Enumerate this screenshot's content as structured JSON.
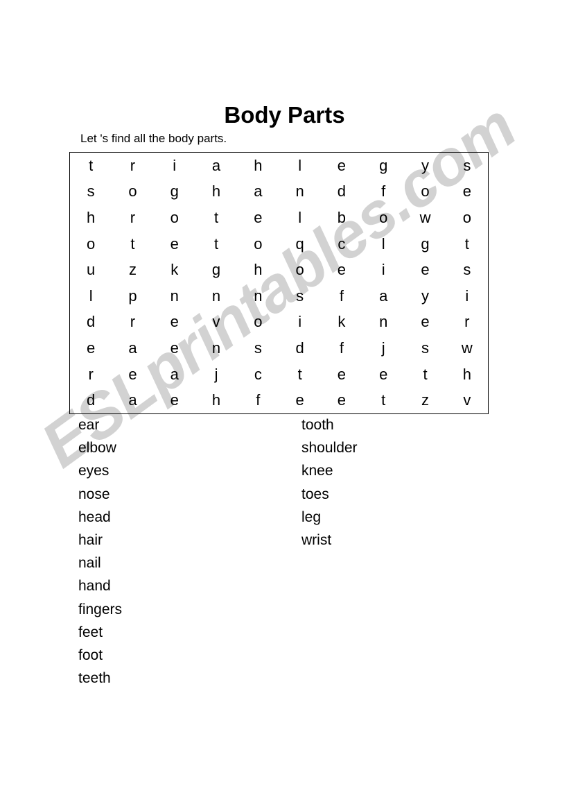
{
  "worksheet": {
    "title": "Body Parts",
    "instruction": "Let 's find all the body parts."
  },
  "watermark": {
    "text": "ESLprintables.com",
    "color": "#d2d2d2"
  },
  "puzzle": {
    "rows": 10,
    "cols": 10,
    "grid": [
      [
        "t",
        "r",
        "i",
        "a",
        "h",
        "l",
        "e",
        "g",
        "y",
        "s"
      ],
      [
        "s",
        "o",
        "g",
        "h",
        "a",
        "n",
        "d",
        "f",
        "o",
        "e"
      ],
      [
        "h",
        "r",
        "o",
        "t",
        "e",
        "l",
        "b",
        "o",
        "w",
        "o"
      ],
      [
        "o",
        "t",
        "e",
        "t",
        "o",
        "q",
        "c",
        "l",
        "g",
        "t"
      ],
      [
        "u",
        "z",
        "k",
        "g",
        "h",
        "o",
        "e",
        "i",
        "e",
        "s"
      ],
      [
        "l",
        "p",
        "n",
        "n",
        "n",
        "s",
        "f",
        "a",
        "y",
        "i"
      ],
      [
        "d",
        "r",
        "e",
        "v",
        "o",
        "i",
        "k",
        "n",
        "e",
        "r"
      ],
      [
        "e",
        "a",
        "e",
        "n",
        "s",
        "d",
        "f",
        "j",
        "s",
        "w"
      ],
      [
        "r",
        "e",
        "a",
        "j",
        "c",
        "t",
        "e",
        "e",
        "t",
        "h"
      ],
      [
        "d",
        "a",
        "e",
        "h",
        "f",
        "e",
        "e",
        "t",
        "z",
        "v"
      ]
    ]
  },
  "word_lists": {
    "left": [
      "ear",
      "elbow",
      "eyes",
      "nose",
      "head",
      "hair",
      "nail",
      "hand",
      "fingers",
      "feet",
      "foot",
      "teeth"
    ],
    "right": [
      "tooth",
      "shoulder",
      "knee",
      "toes",
      "leg",
      "wrist"
    ]
  }
}
